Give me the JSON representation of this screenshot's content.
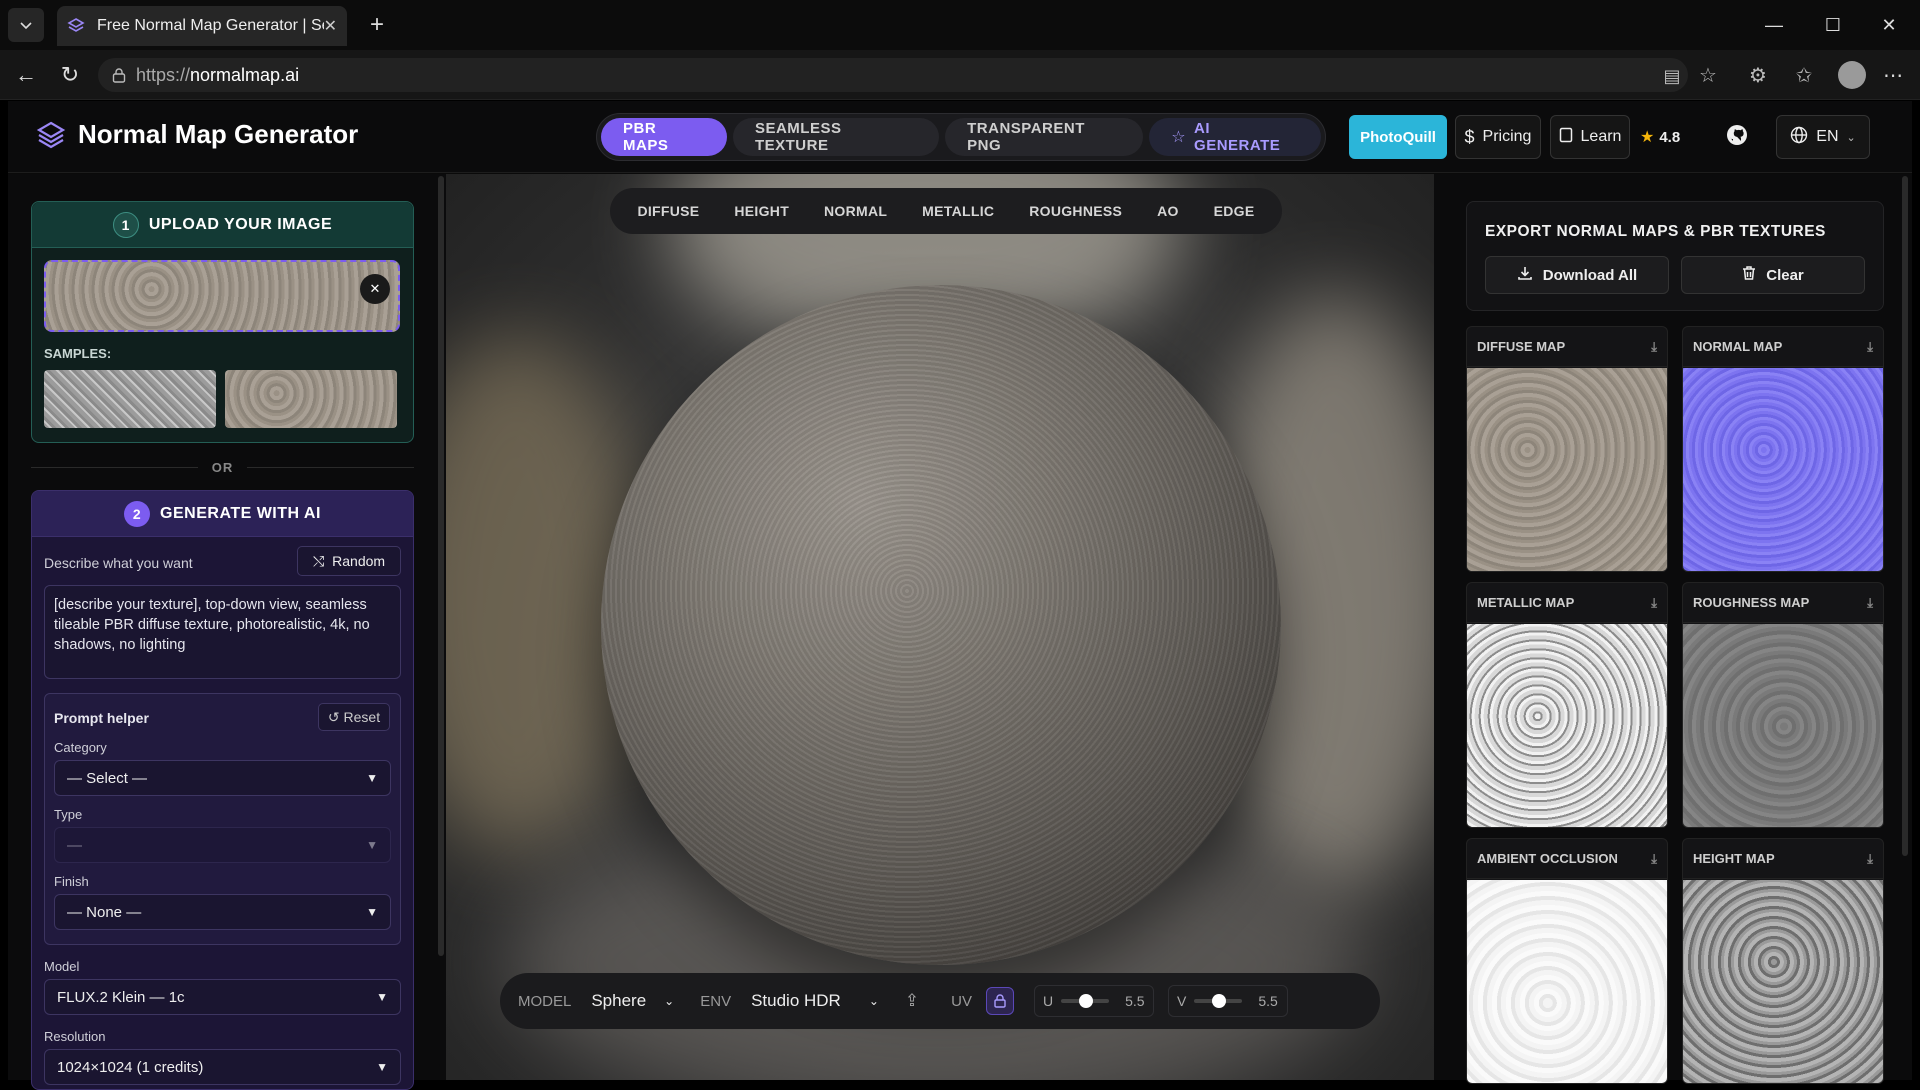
{
  "browser": {
    "tab_title": "Free Normal Map Generator | Sear",
    "url_scheme": "https://",
    "url_host": "normalmap.ai"
  },
  "header": {
    "brand": "Normal Map Generator",
    "modes": [
      "PBR MAPS",
      "SEAMLESS TEXTURE",
      "TRANSPARENT PNG",
      "AI GENERATE"
    ],
    "photoquill": "PhotoQuill",
    "pricing": "Pricing",
    "learn": "Learn",
    "rating": "4.8",
    "language": "EN"
  },
  "upload": {
    "step": "1",
    "title": "UPLOAD YOUR IMAGE",
    "samples_label": "SAMPLES:",
    "or_label": "OR"
  },
  "generate": {
    "step": "2",
    "title": "GENERATE WITH AI",
    "describe_label": "Describe what you want",
    "random": "Random",
    "prompt": "[describe your texture], top-down view, seamless tileable PBR diffuse texture, photorealistic, 4k, no shadows, no lighting",
    "helper_label": "Prompt helper",
    "reset": "↺ Reset",
    "category_label": "Category",
    "category_value": "— Select —",
    "type_label": "Type",
    "type_value": "—",
    "finish_label": "Finish",
    "finish_value": "— None —",
    "model_label": "Model",
    "model_value": "FLUX.2 Klein — 1c",
    "resolution_label": "Resolution",
    "resolution_value": "1024×1024 (1 credits)"
  },
  "viewport": {
    "map_tabs": [
      "DIFFUSE",
      "HEIGHT",
      "NORMAL",
      "METALLIC",
      "ROUGHNESS",
      "AO",
      "EDGE"
    ],
    "model_label": "MODEL",
    "model_value": "Sphere",
    "env_label": "ENV",
    "env_value": "Studio HDR",
    "uv_label": "UV",
    "u_label": "U",
    "u_value": "5.5",
    "v_label": "V",
    "v_value": "5.5"
  },
  "export": {
    "title": "EXPORT NORMAL MAPS & PBR TEXTURES",
    "download_all": "Download All",
    "clear": "Clear"
  },
  "maps": [
    {
      "label": "DIFFUSE MAP"
    },
    {
      "label": "NORMAL MAP"
    },
    {
      "label": "METALLIC MAP"
    },
    {
      "label": "ROUGHNESS MAP"
    },
    {
      "label": "AMBIENT OCCLUSION"
    },
    {
      "label": "HEIGHT MAP"
    }
  ],
  "colors": {
    "accent": "#7c5cf0",
    "teal": "#245e55",
    "photoquill": "#2bb5d9",
    "normal_map": "#7d74f0"
  }
}
